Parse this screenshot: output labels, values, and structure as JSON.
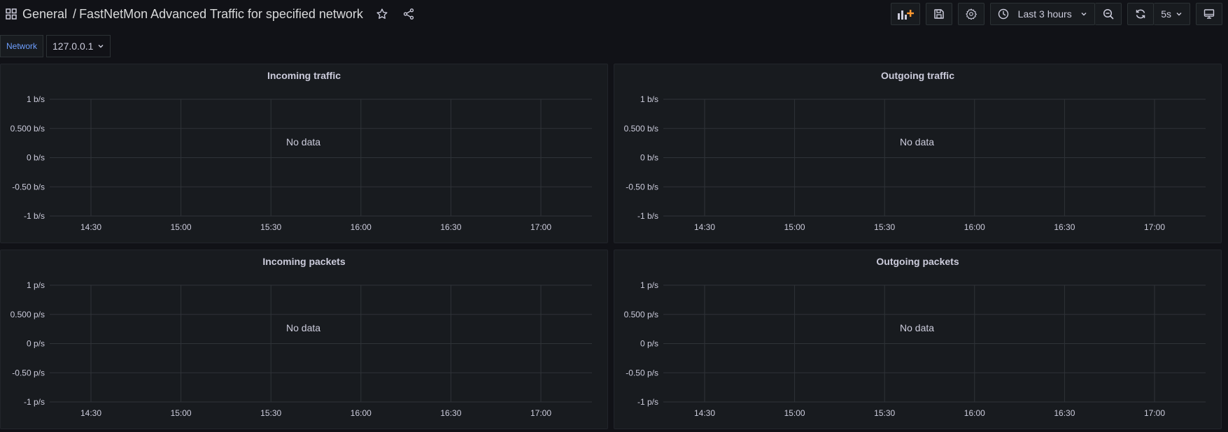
{
  "navbar": {
    "breadcrumb_folder": "General",
    "breadcrumb_separator": "/",
    "breadcrumb_dashboard": "FastNetMon Advanced Traffic for specified network",
    "time_range_label": "Last 3 hours",
    "refresh_interval_label": "5s"
  },
  "variables": {
    "network_label": "Network",
    "network_value": "127.0.0.1"
  },
  "colors": {
    "background": "#111217",
    "panel": "#181b1f",
    "grid": "#2f3338",
    "accent_orange": "#ff9830",
    "variable_label": "#6e9fff"
  },
  "panels": [
    {
      "title": "Incoming traffic",
      "no_data": "No data",
      "y_ticks": [
        "1 b/s",
        "0.500 b/s",
        "0 b/s",
        "-0.50 b/s",
        "-1 b/s"
      ],
      "x_ticks": [
        "14:30",
        "15:00",
        "15:30",
        "16:00",
        "16:30",
        "17:00"
      ]
    },
    {
      "title": "Outgoing traffic",
      "no_data": "No data",
      "y_ticks": [
        "1 b/s",
        "0.500 b/s",
        "0 b/s",
        "-0.50 b/s",
        "-1 b/s"
      ],
      "x_ticks": [
        "14:30",
        "15:00",
        "15:30",
        "16:00",
        "16:30",
        "17:00"
      ]
    },
    {
      "title": "Incoming packets",
      "no_data": "No data",
      "y_ticks": [
        "1 p/s",
        "0.500 p/s",
        "0 p/s",
        "-0.50 p/s",
        "-1 p/s"
      ],
      "x_ticks": [
        "14:30",
        "15:00",
        "15:30",
        "16:00",
        "16:30",
        "17:00"
      ]
    },
    {
      "title": "Outgoing packets",
      "no_data": "No data",
      "y_ticks": [
        "1 p/s",
        "0.500 p/s",
        "0 p/s",
        "-0.50 p/s",
        "-1 p/s"
      ],
      "x_ticks": [
        "14:30",
        "15:00",
        "15:30",
        "16:00",
        "16:30",
        "17:00"
      ]
    }
  ]
}
